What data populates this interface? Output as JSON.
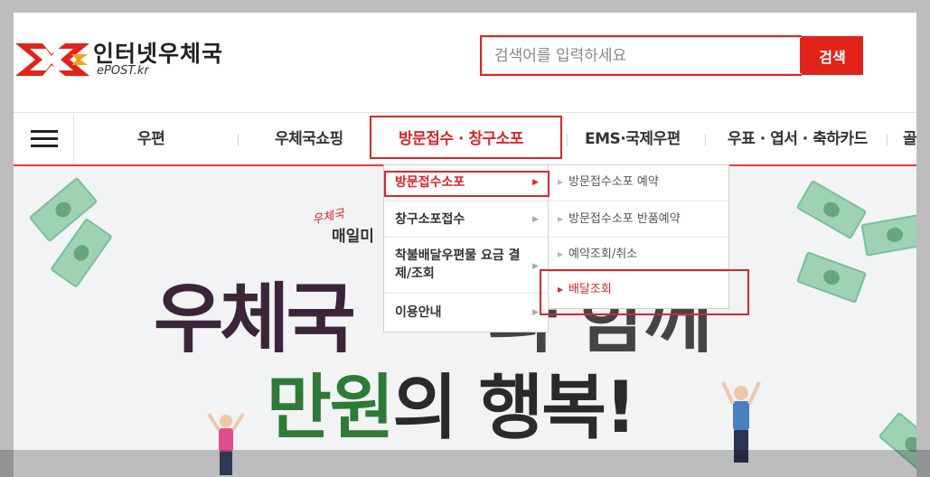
{
  "header": {
    "logo_title": "인터넷우체국",
    "logo_sub": "ePOST.kr",
    "search": {
      "placeholder": "검색어를 입력하세요",
      "button": "검색"
    }
  },
  "nav": {
    "items": [
      {
        "label": "우편"
      },
      {
        "label": "우체국쇼핑"
      },
      {
        "label": "방문접수 · 창구소포"
      },
      {
        "label": "EMS·국제우편"
      },
      {
        "label": "우표 · 엽서 · 축하카드"
      },
      {
        "label": "골드"
      }
    ]
  },
  "dropdown": {
    "col1": [
      {
        "label": "방문접수소포",
        "active": true
      },
      {
        "label": "창구소포접수"
      },
      {
        "label": "착불배달우편물 요금 결제/조회"
      },
      {
        "label": "이용안내"
      }
    ],
    "col2": [
      {
        "label": "방문접수소포 예약"
      },
      {
        "label": "방문접수소포 반품예약"
      },
      {
        "label": "예약조회/취소"
      },
      {
        "label": "배달조회",
        "active": true
      }
    ]
  },
  "banner": {
    "script_text": "우체국",
    "head_text": "매일미",
    "line1": "우체국",
    "line1_rest": "과 함께",
    "line2_green": "만원",
    "line2_rest": "의 행복!"
  },
  "colors": {
    "accent": "#e2231a",
    "highlight": "#d8262c"
  }
}
